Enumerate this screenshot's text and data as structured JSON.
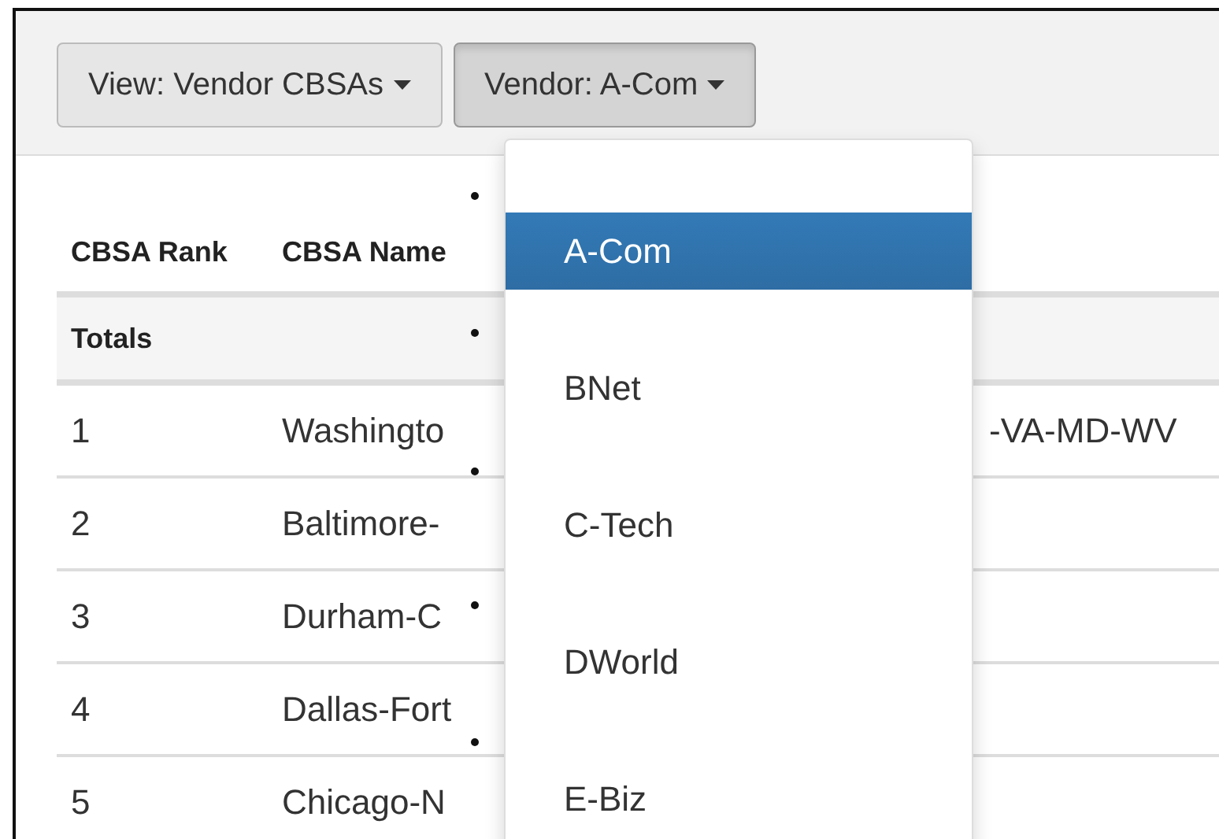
{
  "toolbar": {
    "buttons": [
      {
        "label": "View: Vendor CBSAs",
        "pressed": false
      },
      {
        "label": "Vendor: A-Com",
        "pressed": true
      }
    ]
  },
  "table": {
    "columns": [
      "CBSA Rank",
      "CBSA Name"
    ],
    "totals": {
      "label": "Totals"
    },
    "rows": [
      {
        "rank": "1",
        "name": "Washingto",
        "column_3": "-VA-MD-WV"
      },
      {
        "rank": "2",
        "name": "Baltimore-"
      },
      {
        "rank": "3",
        "name": "Durham-C"
      },
      {
        "rank": "4",
        "name": "Dallas-Fort"
      },
      {
        "rank": "5",
        "name": "Chicago-N"
      }
    ]
  },
  "dropdown": {
    "items": [
      {
        "label": "A-Com",
        "selected": true
      },
      {
        "label": "BNet",
        "selected": false
      },
      {
        "label": "C-Tech",
        "selected": false
      },
      {
        "label": "DWorld",
        "selected": false
      },
      {
        "label": "E-Biz",
        "selected": false
      }
    ]
  }
}
